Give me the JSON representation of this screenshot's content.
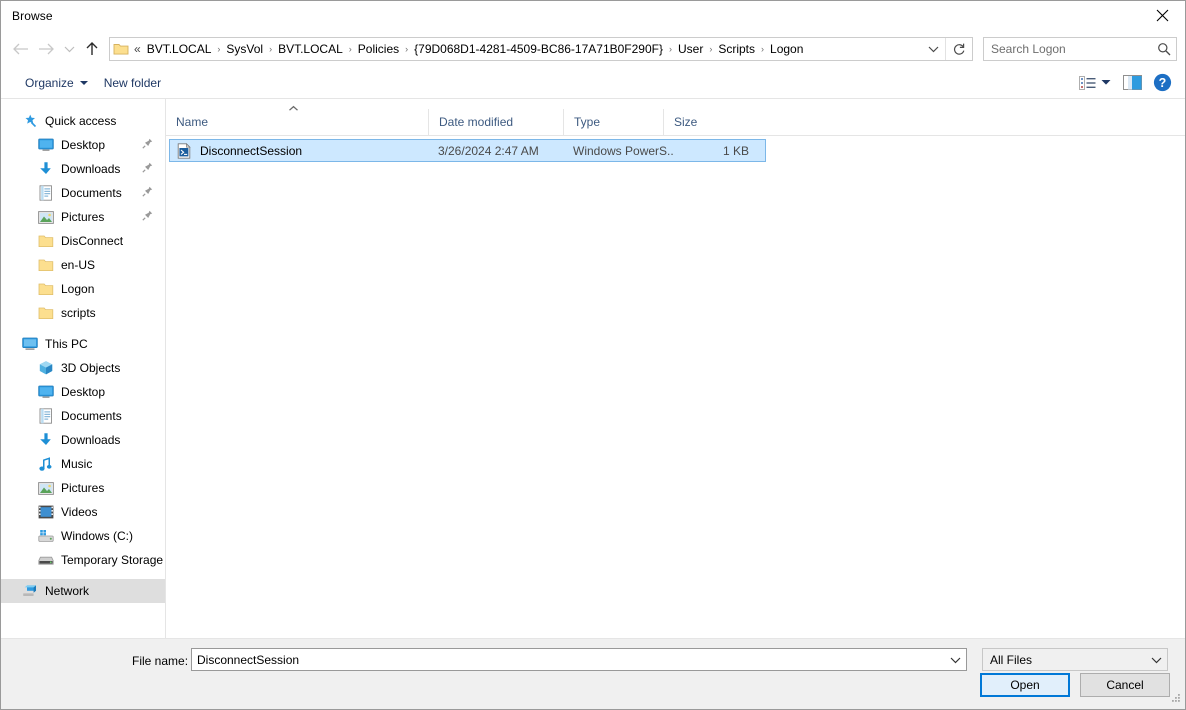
{
  "window": {
    "title": "Browse",
    "close_icon": "close-icon"
  },
  "nav": {
    "back_icon": "back-arrow-icon",
    "forward_icon": "forward-arrow-icon",
    "recent_icon": "chevron-down-icon",
    "up_icon": "up-arrow-icon",
    "address_folder_icon": "folder-icon",
    "lead": "«",
    "breadcrumbs": [
      "BVT.LOCAL",
      "SysVol",
      "BVT.LOCAL",
      "Policies",
      "{79D068D1-4281-4509-BC86-17A71B0F290F}",
      "User",
      "Scripts",
      "Logon"
    ],
    "separator": "›",
    "address_dropdown_icon": "chevron-down-icon",
    "refresh_icon": "refresh-icon"
  },
  "search": {
    "placeholder": "Search Logon",
    "value": "",
    "icon": "search-icon"
  },
  "toolbar": {
    "organize_label": "Organize",
    "new_folder_label": "New folder",
    "view_options_icon": "list-view-icon",
    "view_dropdown_icon": "chevron-down-icon",
    "preview_pane_icon": "preview-pane-icon",
    "help_icon": "help-icon"
  },
  "sidebar": {
    "groups": [
      {
        "name": "quick-access",
        "header": {
          "label": "Quick access",
          "icon": "star-pin-icon",
          "level": 0,
          "selected": false
        },
        "items": [
          {
            "label": "Desktop",
            "icon": "desktop-icon",
            "pinned": true
          },
          {
            "label": "Downloads",
            "icon": "downloads-icon",
            "pinned": true
          },
          {
            "label": "Documents",
            "icon": "documents-icon",
            "pinned": true
          },
          {
            "label": "Pictures",
            "icon": "pictures-icon",
            "pinned": true
          },
          {
            "label": "DisConnect",
            "icon": "folder-icon",
            "pinned": false
          },
          {
            "label": "en-US",
            "icon": "folder-icon",
            "pinned": false
          },
          {
            "label": "Logon",
            "icon": "folder-icon",
            "pinned": false
          },
          {
            "label": "scripts",
            "icon": "folder-icon",
            "pinned": false
          }
        ]
      },
      {
        "name": "this-pc",
        "header": {
          "label": "This PC",
          "icon": "this-pc-icon",
          "level": 0,
          "selected": false
        },
        "items": [
          {
            "label": "3D Objects",
            "icon": "3d-objects-icon",
            "pinned": false
          },
          {
            "label": "Desktop",
            "icon": "desktop-icon",
            "pinned": false
          },
          {
            "label": "Documents",
            "icon": "documents-icon",
            "pinned": false
          },
          {
            "label": "Downloads",
            "icon": "downloads-icon",
            "pinned": false
          },
          {
            "label": "Music",
            "icon": "music-icon",
            "pinned": false
          },
          {
            "label": "Pictures",
            "icon": "pictures-icon",
            "pinned": false
          },
          {
            "label": "Videos",
            "icon": "videos-icon",
            "pinned": false
          },
          {
            "label": "Windows (C:)",
            "icon": "drive-icon",
            "pinned": false
          },
          {
            "label": "Temporary Storage",
            "icon": "drive-icon",
            "pinned": false
          }
        ]
      },
      {
        "name": "network",
        "header": {
          "label": "Network",
          "icon": "network-icon",
          "level": 0,
          "selected": true
        },
        "items": []
      }
    ]
  },
  "filelist": {
    "columns": [
      {
        "label": "Name",
        "sorted": "asc"
      },
      {
        "label": "Date modified",
        "sorted": ""
      },
      {
        "label": "Type",
        "sorted": ""
      },
      {
        "label": "Size",
        "sorted": ""
      }
    ],
    "rows": [
      {
        "name": "DisconnectSession",
        "date_modified": "3/26/2024 2:47 AM",
        "type": "Windows PowerS...",
        "size": "1 KB",
        "icon": "powershell-script-icon",
        "selected": true
      }
    ]
  },
  "footer": {
    "file_name_label": "File name:",
    "file_name_value": "DisconnectSession",
    "file_name_dropdown_icon": "chevron-down-icon",
    "file_type_value": "All Files",
    "file_type_dropdown_icon": "chevron-down-icon",
    "open_label": "Open",
    "cancel_label": "Cancel",
    "resize_grip_icon": "resize-grip-icon"
  },
  "colors": {
    "accent": "#0078d7",
    "selection_fill": "#cde8ff",
    "selection_border": "#7cb7e8",
    "toolbar_text": "#1f3864",
    "column_header_text": "#3d5a80",
    "sidebar_selected": "#dedede",
    "footer_bg": "#f0f0f0"
  }
}
